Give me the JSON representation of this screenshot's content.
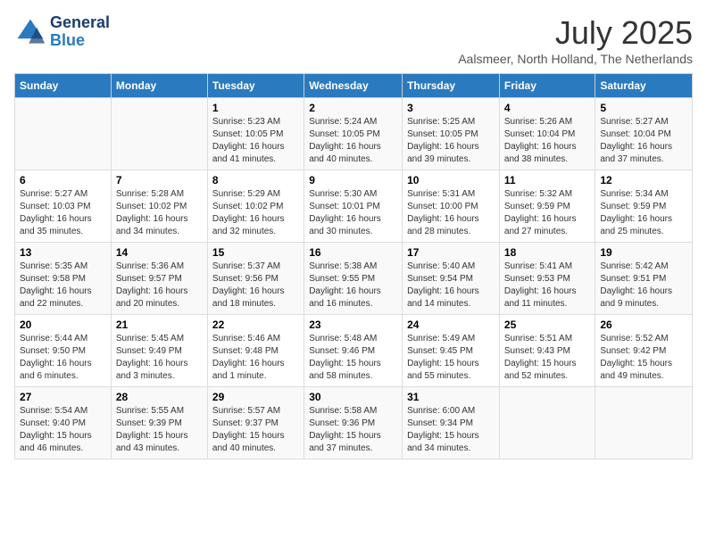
{
  "header": {
    "logo_line1": "General",
    "logo_line2": "Blue",
    "month_year": "July 2025",
    "location": "Aalsmeer, North Holland, The Netherlands"
  },
  "days_of_week": [
    "Sunday",
    "Monday",
    "Tuesday",
    "Wednesday",
    "Thursday",
    "Friday",
    "Saturday"
  ],
  "weeks": [
    [
      {
        "day": "",
        "detail": ""
      },
      {
        "day": "",
        "detail": ""
      },
      {
        "day": "1",
        "detail": "Sunrise: 5:23 AM\nSunset: 10:05 PM\nDaylight: 16 hours and 41 minutes."
      },
      {
        "day": "2",
        "detail": "Sunrise: 5:24 AM\nSunset: 10:05 PM\nDaylight: 16 hours and 40 minutes."
      },
      {
        "day": "3",
        "detail": "Sunrise: 5:25 AM\nSunset: 10:05 PM\nDaylight: 16 hours and 39 minutes."
      },
      {
        "day": "4",
        "detail": "Sunrise: 5:26 AM\nSunset: 10:04 PM\nDaylight: 16 hours and 38 minutes."
      },
      {
        "day": "5",
        "detail": "Sunrise: 5:27 AM\nSunset: 10:04 PM\nDaylight: 16 hours and 37 minutes."
      }
    ],
    [
      {
        "day": "6",
        "detail": "Sunrise: 5:27 AM\nSunset: 10:03 PM\nDaylight: 16 hours and 35 minutes."
      },
      {
        "day": "7",
        "detail": "Sunrise: 5:28 AM\nSunset: 10:02 PM\nDaylight: 16 hours and 34 minutes."
      },
      {
        "day": "8",
        "detail": "Sunrise: 5:29 AM\nSunset: 10:02 PM\nDaylight: 16 hours and 32 minutes."
      },
      {
        "day": "9",
        "detail": "Sunrise: 5:30 AM\nSunset: 10:01 PM\nDaylight: 16 hours and 30 minutes."
      },
      {
        "day": "10",
        "detail": "Sunrise: 5:31 AM\nSunset: 10:00 PM\nDaylight: 16 hours and 28 minutes."
      },
      {
        "day": "11",
        "detail": "Sunrise: 5:32 AM\nSunset: 9:59 PM\nDaylight: 16 hours and 27 minutes."
      },
      {
        "day": "12",
        "detail": "Sunrise: 5:34 AM\nSunset: 9:59 PM\nDaylight: 16 hours and 25 minutes."
      }
    ],
    [
      {
        "day": "13",
        "detail": "Sunrise: 5:35 AM\nSunset: 9:58 PM\nDaylight: 16 hours and 22 minutes."
      },
      {
        "day": "14",
        "detail": "Sunrise: 5:36 AM\nSunset: 9:57 PM\nDaylight: 16 hours and 20 minutes."
      },
      {
        "day": "15",
        "detail": "Sunrise: 5:37 AM\nSunset: 9:56 PM\nDaylight: 16 hours and 18 minutes."
      },
      {
        "day": "16",
        "detail": "Sunrise: 5:38 AM\nSunset: 9:55 PM\nDaylight: 16 hours and 16 minutes."
      },
      {
        "day": "17",
        "detail": "Sunrise: 5:40 AM\nSunset: 9:54 PM\nDaylight: 16 hours and 14 minutes."
      },
      {
        "day": "18",
        "detail": "Sunrise: 5:41 AM\nSunset: 9:53 PM\nDaylight: 16 hours and 11 minutes."
      },
      {
        "day": "19",
        "detail": "Sunrise: 5:42 AM\nSunset: 9:51 PM\nDaylight: 16 hours and 9 minutes."
      }
    ],
    [
      {
        "day": "20",
        "detail": "Sunrise: 5:44 AM\nSunset: 9:50 PM\nDaylight: 16 hours and 6 minutes."
      },
      {
        "day": "21",
        "detail": "Sunrise: 5:45 AM\nSunset: 9:49 PM\nDaylight: 16 hours and 3 minutes."
      },
      {
        "day": "22",
        "detail": "Sunrise: 5:46 AM\nSunset: 9:48 PM\nDaylight: 16 hours and 1 minute."
      },
      {
        "day": "23",
        "detail": "Sunrise: 5:48 AM\nSunset: 9:46 PM\nDaylight: 15 hours and 58 minutes."
      },
      {
        "day": "24",
        "detail": "Sunrise: 5:49 AM\nSunset: 9:45 PM\nDaylight: 15 hours and 55 minutes."
      },
      {
        "day": "25",
        "detail": "Sunrise: 5:51 AM\nSunset: 9:43 PM\nDaylight: 15 hours and 52 minutes."
      },
      {
        "day": "26",
        "detail": "Sunrise: 5:52 AM\nSunset: 9:42 PM\nDaylight: 15 hours and 49 minutes."
      }
    ],
    [
      {
        "day": "27",
        "detail": "Sunrise: 5:54 AM\nSunset: 9:40 PM\nDaylight: 15 hours and 46 minutes."
      },
      {
        "day": "28",
        "detail": "Sunrise: 5:55 AM\nSunset: 9:39 PM\nDaylight: 15 hours and 43 minutes."
      },
      {
        "day": "29",
        "detail": "Sunrise: 5:57 AM\nSunset: 9:37 PM\nDaylight: 15 hours and 40 minutes."
      },
      {
        "day": "30",
        "detail": "Sunrise: 5:58 AM\nSunset: 9:36 PM\nDaylight: 15 hours and 37 minutes."
      },
      {
        "day": "31",
        "detail": "Sunrise: 6:00 AM\nSunset: 9:34 PM\nDaylight: 15 hours and 34 minutes."
      },
      {
        "day": "",
        "detail": ""
      },
      {
        "day": "",
        "detail": ""
      }
    ]
  ]
}
